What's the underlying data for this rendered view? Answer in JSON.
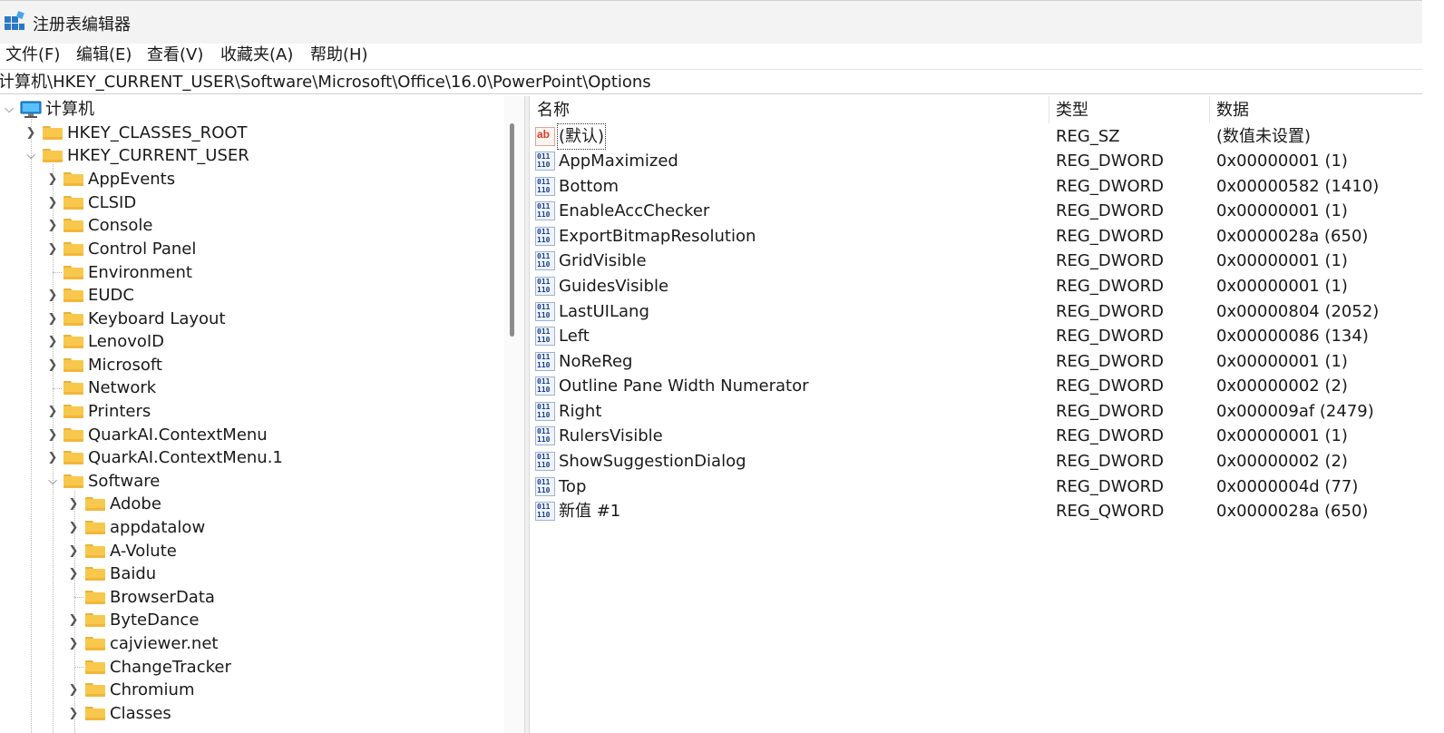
{
  "window": {
    "title": "注册表编辑器",
    "icon": "registry-editor-icon"
  },
  "menu": [
    "文件(F)",
    "编辑(E)",
    "查看(V)",
    "收藏夹(A)",
    "帮助(H)"
  ],
  "address": "计算机\\HKEY_CURRENT_USER\\Software\\Microsoft\\Office\\16.0\\PowerPoint\\Options",
  "tree": {
    "root": "计算机",
    "hkcr": "HKEY_CLASSES_ROOT",
    "hkcu": "HKEY_CURRENT_USER",
    "hkcu_children": [
      "AppEvents",
      "CLSID",
      "Console",
      "Control Panel",
      "Environment",
      "EUDC",
      "Keyboard Layout",
      "LenovoID",
      "Microsoft",
      "Network",
      "Printers",
      "QuarkAI.ContextMenu",
      "QuarkAI.ContextMenu.1",
      "Software"
    ],
    "software_children": [
      "Adobe",
      "appdatalow",
      "A-Volute",
      "Baidu",
      "BrowserData",
      "ByteDance",
      "cajviewer.net",
      "ChangeTracker",
      "Chromium",
      "Classes"
    ]
  },
  "list": {
    "headers": {
      "name": "名称",
      "type": "类型",
      "data": "数据"
    },
    "rows": [
      {
        "name": "(默认)",
        "type": "REG_SZ",
        "data": "(数值未设置)",
        "icon": "string-value-icon"
      },
      {
        "name": "AppMaximized",
        "type": "REG_DWORD",
        "data": "0x00000001 (1)",
        "icon": "binary-value-icon"
      },
      {
        "name": "Bottom",
        "type": "REG_DWORD",
        "data": "0x00000582 (1410)",
        "icon": "binary-value-icon"
      },
      {
        "name": "EnableAccChecker",
        "type": "REG_DWORD",
        "data": "0x00000001 (1)",
        "icon": "binary-value-icon"
      },
      {
        "name": "ExportBitmapResolution",
        "type": "REG_DWORD",
        "data": "0x0000028a (650)",
        "icon": "binary-value-icon"
      },
      {
        "name": "GridVisible",
        "type": "REG_DWORD",
        "data": "0x00000001 (1)",
        "icon": "binary-value-icon"
      },
      {
        "name": "GuidesVisible",
        "type": "REG_DWORD",
        "data": "0x00000001 (1)",
        "icon": "binary-value-icon"
      },
      {
        "name": "LastUILang",
        "type": "REG_DWORD",
        "data": "0x00000804 (2052)",
        "icon": "binary-value-icon"
      },
      {
        "name": "Left",
        "type": "REG_DWORD",
        "data": "0x00000086 (134)",
        "icon": "binary-value-icon"
      },
      {
        "name": "NoReReg",
        "type": "REG_DWORD",
        "data": "0x00000001 (1)",
        "icon": "binary-value-icon"
      },
      {
        "name": "Outline Pane Width Numerator",
        "type": "REG_DWORD",
        "data": "0x00000002 (2)",
        "icon": "binary-value-icon"
      },
      {
        "name": "Right",
        "type": "REG_DWORD",
        "data": "0x000009af (2479)",
        "icon": "binary-value-icon"
      },
      {
        "name": "RulersVisible",
        "type": "REG_DWORD",
        "data": "0x00000001 (1)",
        "icon": "binary-value-icon"
      },
      {
        "name": "ShowSuggestionDialog",
        "type": "REG_DWORD",
        "data": "0x00000002 (2)",
        "icon": "binary-value-icon"
      },
      {
        "name": "Top",
        "type": "REG_DWORD",
        "data": "0x0000004d (77)",
        "icon": "binary-value-icon"
      },
      {
        "name": "新值 #1",
        "type": "REG_QWORD",
        "data": "0x0000028a (650)",
        "icon": "binary-value-icon"
      }
    ]
  }
}
